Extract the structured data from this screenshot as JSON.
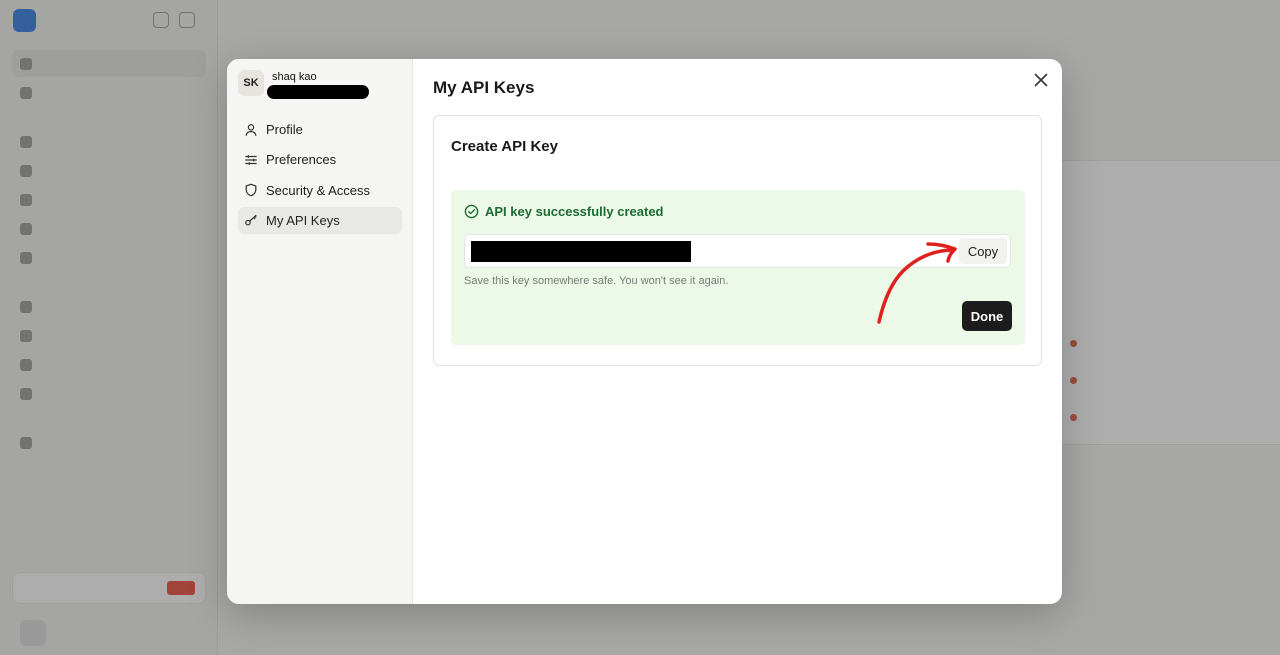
{
  "modal": {
    "user": {
      "initials": "SK",
      "name": "shaq kao"
    },
    "nav": [
      {
        "label": "Profile",
        "icon": "user-icon",
        "active": false
      },
      {
        "label": "Preferences",
        "icon": "sliders-icon",
        "active": false
      },
      {
        "label": "Security & Access",
        "icon": "shield-icon",
        "active": false
      },
      {
        "label": "My API Keys",
        "icon": "key-icon",
        "active": true
      }
    ],
    "title": "My API Keys",
    "close_icon": "close-icon",
    "card": {
      "title": "Create API Key",
      "success_message": "API key successfully created",
      "copy_label": "Copy",
      "hint": "Save this key somewhere safe. You won't see it again.",
      "done_label": "Done"
    }
  },
  "colors": {
    "success_bg": "#ecf8e8",
    "success_text": "#1e6b34",
    "primary_button": "#1c1c1c",
    "annotation": "#e0201c"
  }
}
